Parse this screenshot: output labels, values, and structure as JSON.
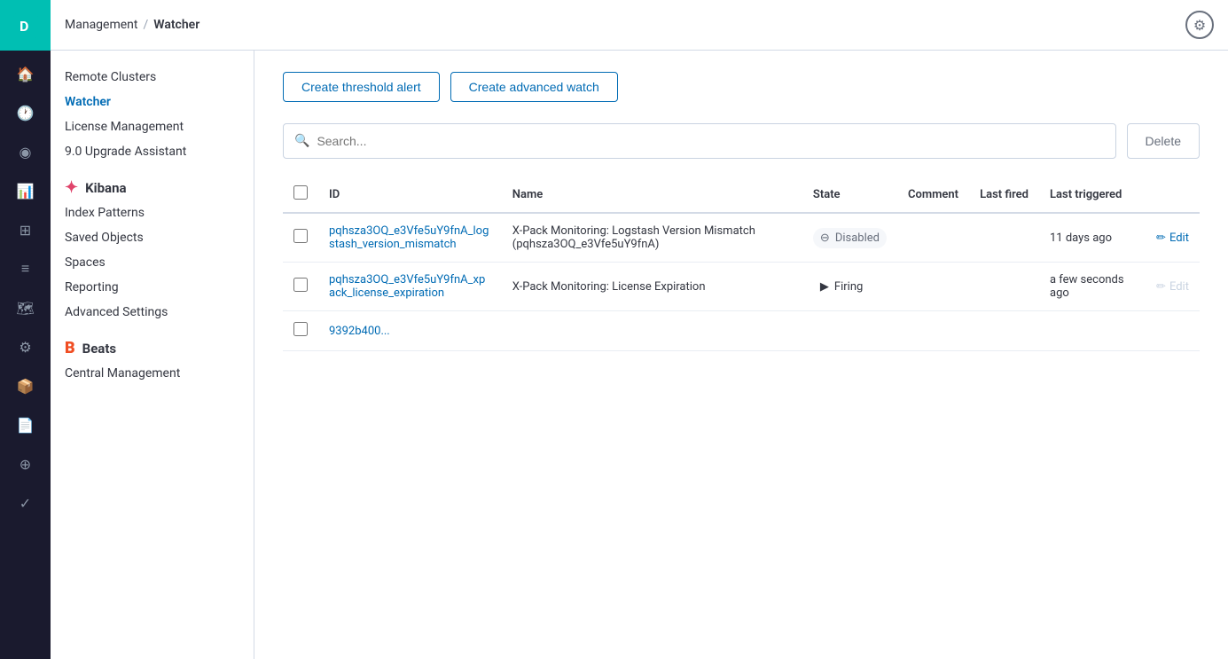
{
  "app": {
    "logo_letter": "D",
    "logo_bg": "#00bfb3"
  },
  "topbar": {
    "breadcrumb_parent": "Management",
    "breadcrumb_sep": "/",
    "breadcrumb_current": "Watcher",
    "user_icon_label": "user-settings"
  },
  "sidebar": {
    "sections": [
      {
        "id": "management",
        "items": [
          {
            "id": "remote-clusters",
            "label": "Remote Clusters",
            "active": false
          },
          {
            "id": "watcher",
            "label": "Watcher",
            "active": true
          },
          {
            "id": "license-management",
            "label": "License Management",
            "active": false
          },
          {
            "id": "upgrade-assistant",
            "label": "9.0 Upgrade Assistant",
            "active": false
          }
        ]
      },
      {
        "id": "kibana",
        "title": "Kibana",
        "icon_type": "kibana",
        "items": [
          {
            "id": "index-patterns",
            "label": "Index Patterns",
            "active": false
          },
          {
            "id": "saved-objects",
            "label": "Saved Objects",
            "active": false
          },
          {
            "id": "spaces",
            "label": "Spaces",
            "active": false
          },
          {
            "id": "reporting",
            "label": "Reporting",
            "active": false
          },
          {
            "id": "advanced-settings",
            "label": "Advanced Settings",
            "active": false
          }
        ]
      },
      {
        "id": "beats",
        "title": "Beats",
        "icon_type": "beats",
        "items": [
          {
            "id": "central-management",
            "label": "Central Management",
            "active": false
          }
        ]
      }
    ]
  },
  "main": {
    "buttons": {
      "create_threshold": "Create threshold alert",
      "create_advanced": "Create advanced watch"
    },
    "search": {
      "placeholder": "Search...",
      "delete_label": "Delete"
    },
    "table": {
      "columns": [
        "",
        "ID",
        "Name",
        "State",
        "Comment",
        "Last fired",
        "Last triggered",
        ""
      ],
      "rows": [
        {
          "id": "pqhsza3OQ_e3Vfe5uY9fnA_logstash_version_mismatch",
          "name": "X-Pack Monitoring: Logstash Version Mismatch (pqhsza3OQ_e3Vfe5uY9fnA)",
          "state": "Disabled",
          "state_type": "disabled",
          "comment": "",
          "last_fired": "",
          "last_triggered": "11 days ago",
          "edit_label": "Edit",
          "edit_enabled": true
        },
        {
          "id": "pqhsza3OQ_e3Vfe5uY9fnA_xpack_license_expiration",
          "name": "X-Pack Monitoring: License Expiration",
          "state": "Firing",
          "state_type": "firing",
          "comment": "",
          "last_fired": "",
          "last_triggered": "a few seconds ago",
          "edit_label": "Edit",
          "edit_enabled": false
        },
        {
          "id": "9392b400...",
          "name": "",
          "state": "",
          "state_type": "",
          "comment": "",
          "last_fired": "",
          "last_triggered": "",
          "edit_label": "",
          "edit_enabled": false
        }
      ]
    }
  },
  "icons": {
    "search": "🔍",
    "kibana_k": "K",
    "beats_b": "B",
    "disabled_icon": "⊖",
    "firing_icon": "▶",
    "edit_pencil": "✏",
    "clock": "🕐",
    "home": "⌂",
    "compass": "◎",
    "chart": "📊",
    "grid": "⊞",
    "list": "☰",
    "pin": "📍",
    "puzzle": "⚙",
    "box": "□",
    "star": "★",
    "gear": "⚙",
    "user": "👤"
  }
}
